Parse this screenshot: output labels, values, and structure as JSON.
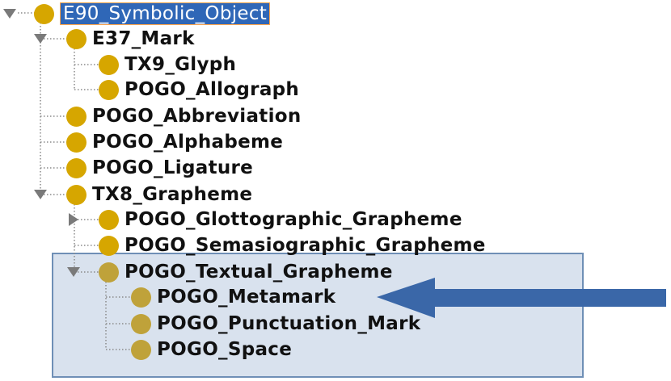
{
  "tree": {
    "root": {
      "label": "E90_Symbolic_Object",
      "icon": "class-node-icon",
      "expanded": true
    },
    "e37": {
      "label": "E37_Mark",
      "icon": "class-node-icon",
      "expanded": true
    },
    "tx9": {
      "label": "TX9_Glyph",
      "icon": "class-node-icon"
    },
    "allograph": {
      "label": "POGO_Allograph",
      "icon": "class-node-icon"
    },
    "abbreviation": {
      "label": "POGO_Abbreviation",
      "icon": "class-node-icon"
    },
    "alphabeme": {
      "label": "POGO_Alphabeme",
      "icon": "class-node-icon"
    },
    "ligature": {
      "label": "POGO_Ligature",
      "icon": "class-node-icon"
    },
    "tx8": {
      "label": "TX8_Grapheme",
      "icon": "class-node-icon",
      "expanded": true
    },
    "glottographic": {
      "label": "POGO_Glottographic_Grapheme",
      "icon": "class-node-icon",
      "expanded": false
    },
    "semasiographic": {
      "label": "POGO_Semasiographic_Grapheme",
      "icon": "class-node-icon"
    },
    "textual": {
      "label": "POGO_Textual_Grapheme",
      "icon": "class-node-icon",
      "expanded": true
    },
    "metamark": {
      "label": "POGO_Metamark",
      "icon": "class-node-icon"
    },
    "punctuation": {
      "label": "POGO_Punctuation_Mark",
      "icon": "class-node-icon"
    },
    "space": {
      "label": "POGO_Space",
      "icon": "class-node-icon"
    }
  },
  "colors": {
    "node": "#d6a600",
    "node_muted": "#bfa23a",
    "selection": "#2f67b7",
    "highlight_box": "#d9e2ee",
    "arrow": "#3a67a8"
  }
}
